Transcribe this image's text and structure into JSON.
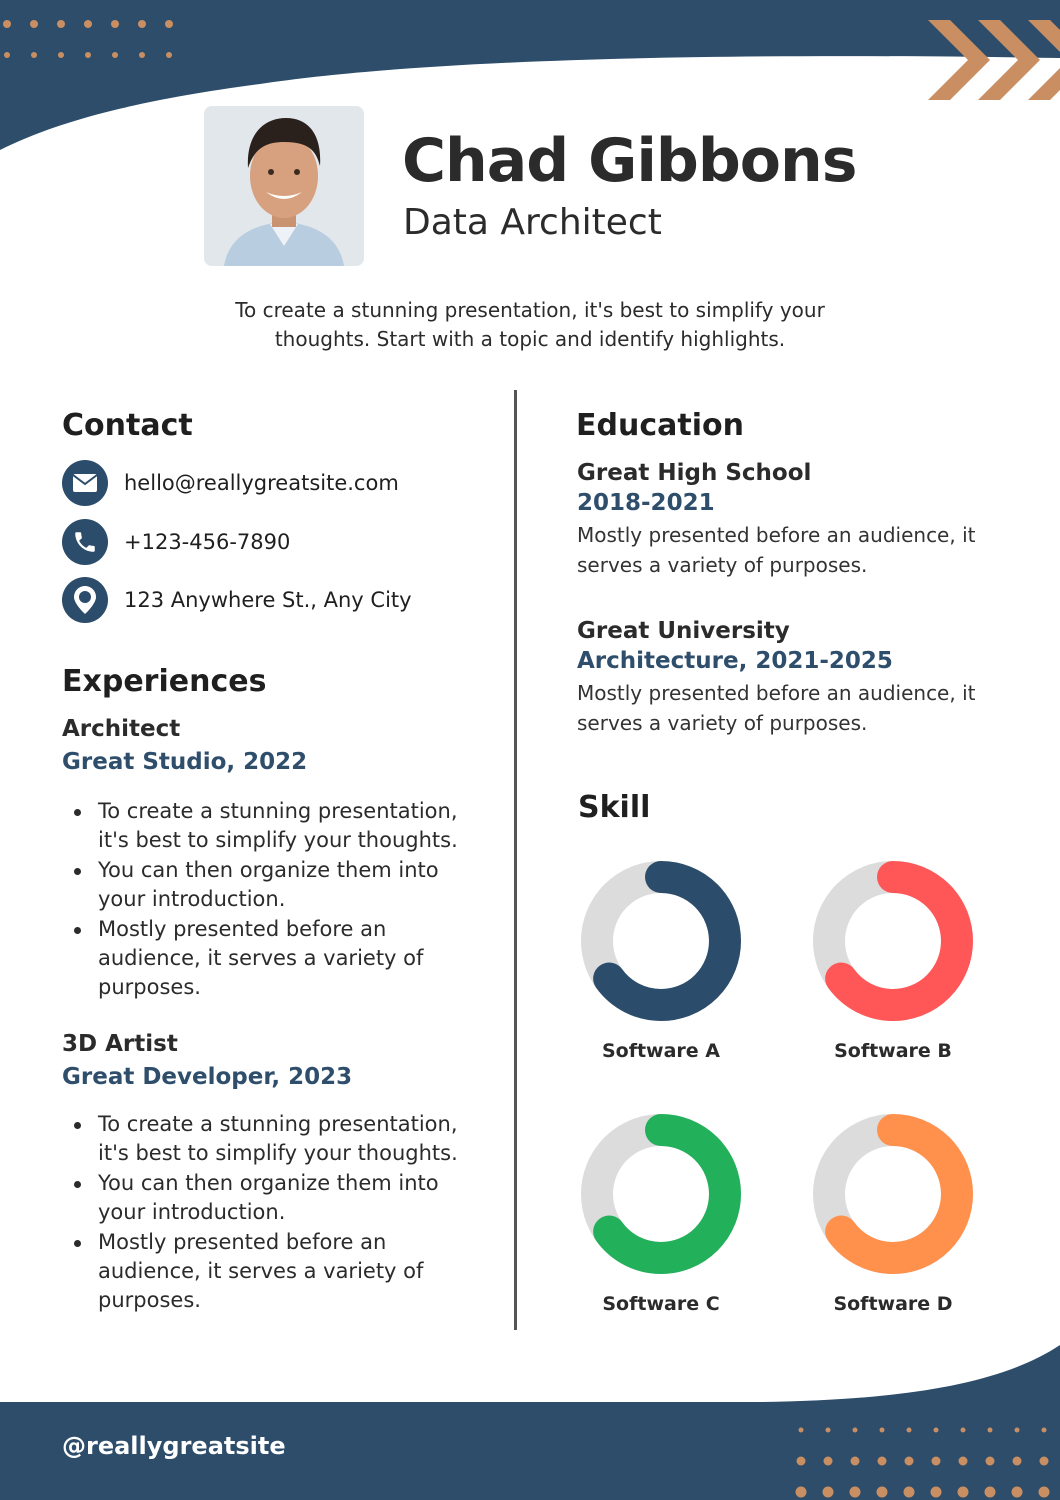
{
  "theme": {
    "navy": "#2b4c6a",
    "accent_tan": "#c98f62",
    "track_gray": "#dcdcdc"
  },
  "header": {
    "name": "Chad Gibbons",
    "role": "Data Architect",
    "intro": "To create a stunning presentation, it's best to simplify your thoughts. Start with a topic and identify highlights.",
    "photo_icon": "profile-photo"
  },
  "contact": {
    "title": "Contact",
    "items": [
      {
        "icon": "mail-icon",
        "text": "hello@reallygreatsite.com"
      },
      {
        "icon": "phone-icon",
        "text": "+123-456-7890"
      },
      {
        "icon": "location-pin-icon",
        "text": "123 Anywhere St., Any City"
      }
    ]
  },
  "experiences": {
    "title": "Experiences",
    "jobs": [
      {
        "title": "Architect",
        "org": "Great Studio, 2022",
        "bullets": [
          "To create a stunning presentation, it's best to simplify your thoughts.",
          "You can then organize them into your introduction.",
          "Mostly presented before an audience, it serves a variety of purposes."
        ]
      },
      {
        "title": "3D Artist",
        "org": "Great Developer, 2023",
        "bullets": [
          "To create a stunning presentation, it's best to simplify your thoughts.",
          "You can then organize them into your introduction.",
          "Mostly presented before an audience, it serves a variety of purposes."
        ]
      }
    ]
  },
  "education": {
    "title": "Education",
    "entries": [
      {
        "name": "Great High School",
        "sub": "2018-2021",
        "desc": "Mostly presented before an audience, it serves a variety of purposes."
      },
      {
        "name": "Great University",
        "sub": "Architecture, 2021-2025",
        "desc": "Mostly presented before an audience, it serves a variety of purposes."
      }
    ]
  },
  "skills": {
    "title": "Skill",
    "items": [
      {
        "label": "Software A",
        "percent": 65,
        "color": "#2b4c6a"
      },
      {
        "label": "Software B",
        "percent": 65,
        "color": "#ff5757"
      },
      {
        "label": "Software C",
        "percent": 65,
        "color": "#22b05a"
      },
      {
        "label": "Software D",
        "percent": 65,
        "color": "#ff914d"
      }
    ]
  },
  "footer": {
    "handle": "@reallygreatsite"
  }
}
